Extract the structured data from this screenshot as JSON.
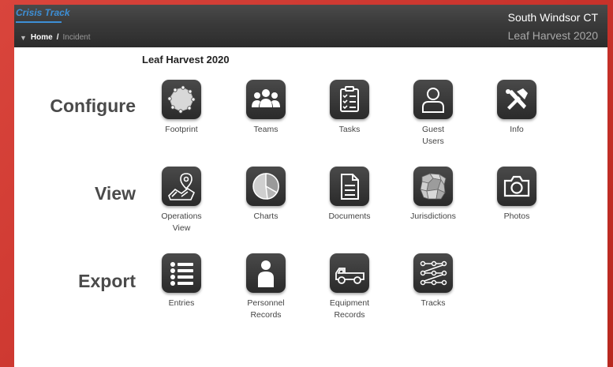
{
  "header": {
    "brand": "Crisis Track",
    "breadcrumb": {
      "home": "Home",
      "separator": "/",
      "current": "Incident"
    },
    "organization": "South Windsor CT",
    "event": "Leaf Harvest 2020"
  },
  "page": {
    "title": "Leaf Harvest 2020"
  },
  "sections": {
    "configure": {
      "label": "Configure",
      "tiles": [
        {
          "label": "Footprint",
          "icon": "footprint-icon"
        },
        {
          "label": "Teams",
          "icon": "teams-icon"
        },
        {
          "label": "Tasks",
          "icon": "tasks-icon"
        },
        {
          "label": "Guest\nUsers",
          "icon": "guest-user-icon"
        },
        {
          "label": "Info",
          "icon": "tools-icon"
        }
      ]
    },
    "view": {
      "label": "View",
      "tiles": [
        {
          "label": "Operations\nView",
          "icon": "map-pin-icon"
        },
        {
          "label": "Charts",
          "icon": "pie-chart-icon"
        },
        {
          "label": "Documents",
          "icon": "document-icon"
        },
        {
          "label": "Jurisdictions",
          "icon": "jurisdictions-map-icon"
        },
        {
          "label": "Photos",
          "icon": "camera-icon"
        }
      ]
    },
    "export": {
      "label": "Export",
      "tiles": [
        {
          "label": "Entries",
          "icon": "list-icon"
        },
        {
          "label": "Personnel\nRecords",
          "icon": "person-icon"
        },
        {
          "label": "Equipment\nRecords",
          "icon": "truck-icon"
        },
        {
          "label": "Tracks",
          "icon": "tracks-icon"
        }
      ]
    }
  },
  "colors": {
    "accent": "#3d8fd6",
    "tile": "#333333",
    "background": "#d9453c"
  }
}
